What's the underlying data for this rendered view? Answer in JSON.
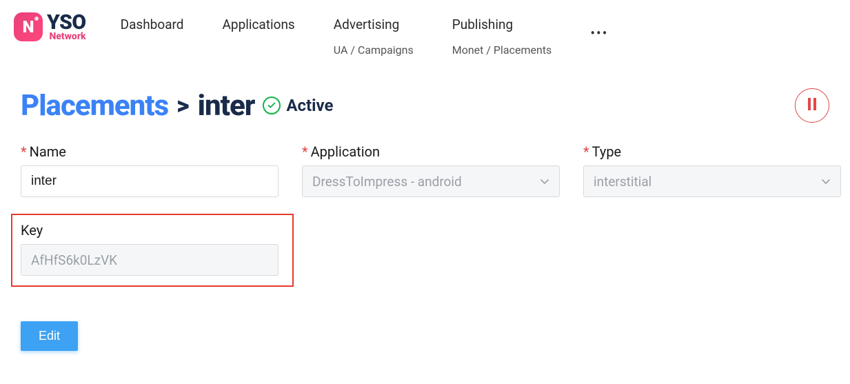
{
  "logo": {
    "badge": "N",
    "brand": "YSO",
    "sub": "Network"
  },
  "nav": {
    "dashboard": "Dashboard",
    "applications": "Applications",
    "advertising": {
      "label": "Advertising",
      "sub": "UA / Campaigns"
    },
    "publishing": {
      "label": "Publishing",
      "sub": "Monet / Placements"
    }
  },
  "page": {
    "breadcrumb_root": "Placements",
    "chevron": ">",
    "current": "inter",
    "status": "Active"
  },
  "form": {
    "name": {
      "label": "Name",
      "value": "inter"
    },
    "application": {
      "label": "Application",
      "value": "DressToImpress - android"
    },
    "type": {
      "label": "Type",
      "value": "interstitial"
    },
    "key": {
      "label": "Key",
      "value": "AfHfS6k0LzVK"
    }
  },
  "actions": {
    "edit": "Edit"
  }
}
